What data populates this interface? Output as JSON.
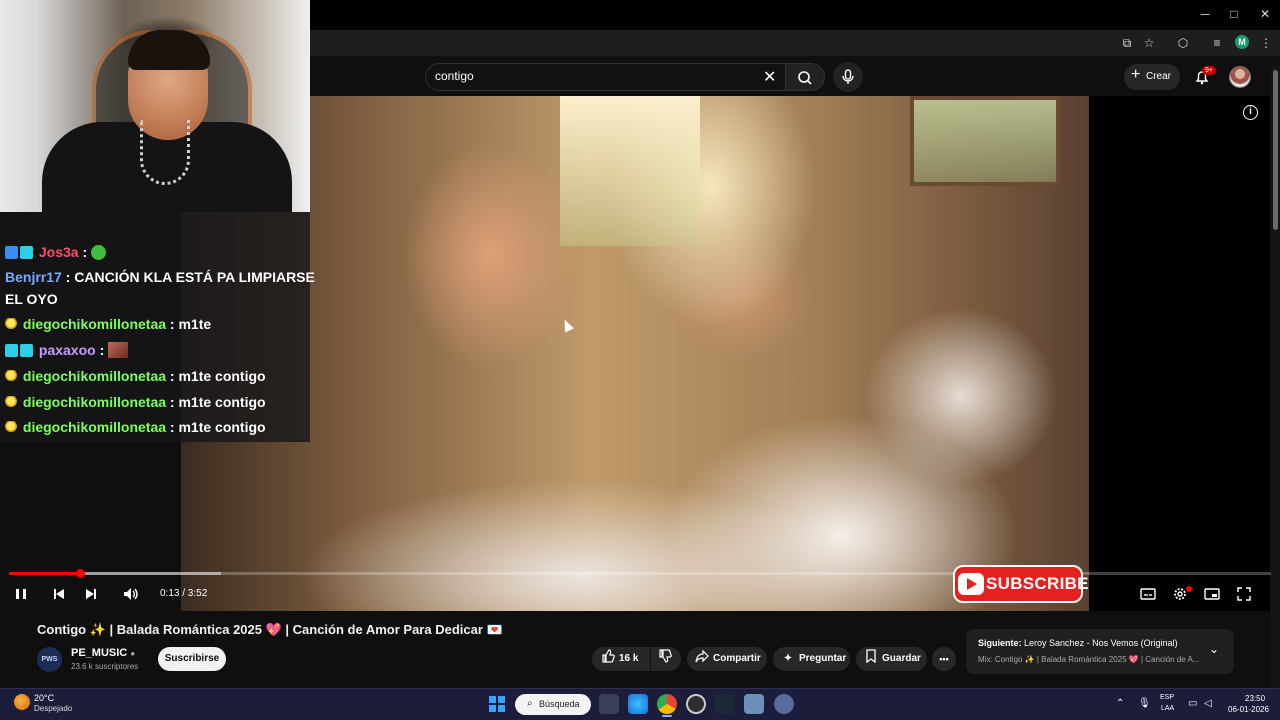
{
  "browser": {
    "minimize": "─",
    "maximize": "□",
    "close": "✕",
    "profile_initial": "M"
  },
  "header": {
    "search_value": "contigo",
    "clear_icon": "close-icon",
    "create_label": "Crear",
    "notifications_badge": "9+"
  },
  "chat": [
    {
      "user": "Jos3a",
      "color": "#ff4d6d",
      "message": ":",
      "badges": [
        "blue",
        "cyan"
      ],
      "emote": "green"
    },
    {
      "user": "Benjrr17",
      "color": "#7aa8ff",
      "message": ": CANCIÓN KLA ESTÁ PA LIMPIARSE",
      "message2": "EL OYO",
      "badges": []
    },
    {
      "user": "diegochikomillonetaa",
      "color": "#7cff5a",
      "message": ": m1te",
      "badges": [
        "bulb"
      ]
    },
    {
      "user": "paxaxoo",
      "color": "#c79cff",
      "message": ":",
      "badges": [
        "cyan",
        "cyan"
      ],
      "emote": "image"
    },
    {
      "user": "diegochikomillonetaa",
      "color": "#7cff5a",
      "message": ": m1te contigo",
      "badges": [
        "bulb"
      ]
    },
    {
      "user": "diegochikomillonetaa",
      "color": "#7cff5a",
      "message": ": m1te contigo",
      "badges": [
        "bulb"
      ]
    },
    {
      "user": "diegochikomillonetaa",
      "color": "#7cff5a",
      "message": ": m1te contigo",
      "badges": [
        "bulb"
      ]
    }
  ],
  "player": {
    "time": "0:13 / 3:52",
    "progress": 0.056,
    "buffered": 0.168,
    "subscribe_overlay": "SUBSCRIBE",
    "accent": "#ff0000"
  },
  "video": {
    "title": "Contigo ✨ | Balada Romántica 2025 💖 | Canción de Amor Para Dedicar 💌",
    "channel_avatar": "PWS",
    "channel_name": "PE_MUSIC",
    "verified": "●",
    "subscribers": "23.6 k suscriptores",
    "subscribe_button": "Suscribirse",
    "likes": "16 k",
    "share": "Compartir",
    "ask": "Preguntar",
    "save": "Guardar",
    "more": "•••"
  },
  "up_next": {
    "label": "Siguiente:",
    "title": "Leroy Sanchez - Nos Vemos (Original)",
    "subtitle": "Mix: Contigo ✨ | Balada Romántica 2025 💖 | Canción de A..."
  },
  "taskbar": {
    "temperature": "20°C",
    "weather": "Despejado",
    "search_label": "Búsqueda",
    "lang1": "ESP",
    "lang2": "LAA",
    "time": "23:50",
    "date": "06-01-2026"
  }
}
